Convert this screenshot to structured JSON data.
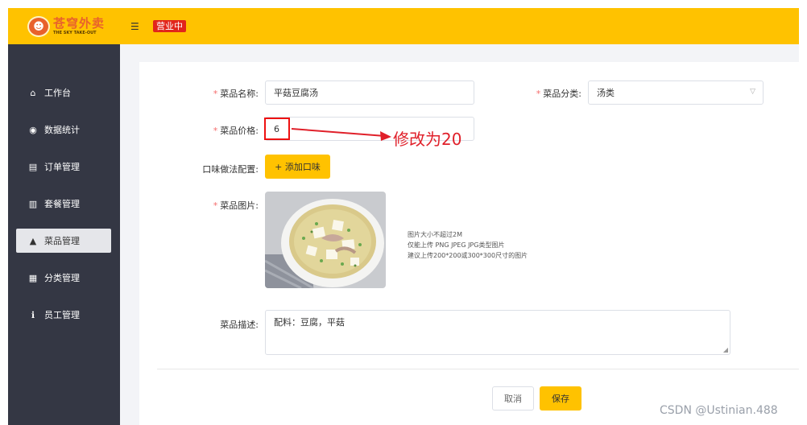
{
  "header": {
    "logo_cn": "苍穹外卖",
    "logo_en": "THE SKY TAKE-OUT",
    "menu_toggle_glyph": "☰",
    "status": "营业中"
  },
  "sidebar": {
    "items": [
      {
        "label": "工作台",
        "icon": "home-icon",
        "glyph": "⌂",
        "active": false
      },
      {
        "label": "数据统计",
        "icon": "chart-icon",
        "glyph": "◉",
        "active": false
      },
      {
        "label": "订单管理",
        "icon": "clipboard-icon",
        "glyph": "▤",
        "active": false
      },
      {
        "label": "套餐管理",
        "icon": "gift-icon",
        "glyph": "▥",
        "active": false
      },
      {
        "label": "菜品管理",
        "icon": "dish-icon",
        "glyph": "▲",
        "active": true
      },
      {
        "label": "分类管理",
        "icon": "grid-icon",
        "glyph": "▦",
        "active": false
      },
      {
        "label": "员工管理",
        "icon": "info-icon",
        "glyph": "ℹ",
        "active": false
      }
    ]
  },
  "form": {
    "name_label": "菜品名称:",
    "name_value": "平菇豆腐汤",
    "category_label": "菜品分类:",
    "category_value": "汤类",
    "price_label": "菜品价格:",
    "price_value": "6",
    "flavor_label": "口味做法配置:",
    "add_flavor_button": "+ 添加口味",
    "image_label": "菜品图片:",
    "image_tips": [
      "图片大小不超过2M",
      "仅能上传 PNG JPEG JPG类型图片",
      "建议上传200*200或300*300尺寸的图片"
    ],
    "desc_label": "菜品描述:",
    "desc_value": "配料：豆腐，平菇",
    "required_mark": "*",
    "cancel_button": "取消",
    "save_button": "保存"
  },
  "annotation": {
    "text": "修改为20",
    "color": "#e0202a"
  },
  "watermark": "CSDN @Ustinian.488",
  "colors": {
    "brand_yellow": "#ffc200",
    "sidebar_bg": "#343744",
    "status_red": "#e1251b"
  }
}
